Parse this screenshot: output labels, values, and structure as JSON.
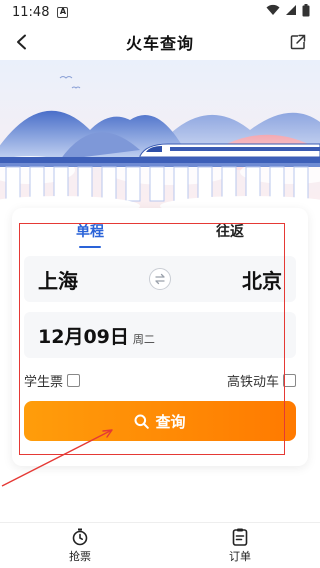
{
  "status_bar": {
    "time": "11:48",
    "app_badge": "A"
  },
  "header": {
    "title": "火车查询"
  },
  "tabs": [
    {
      "label": "单程",
      "active": true
    },
    {
      "label": "往返",
      "active": false
    }
  ],
  "route": {
    "from": "上海",
    "to": "北京"
  },
  "date": {
    "main": "12月09日",
    "weekday": "周二"
  },
  "options": {
    "student_ticket": {
      "label": "学生票",
      "checked": false
    },
    "high_speed": {
      "label": "高铁动车",
      "checked": false
    }
  },
  "search_button": {
    "label": "查询"
  },
  "bottom_nav": [
    {
      "label": "抢票",
      "icon": "stopwatch-icon"
    },
    {
      "label": "订单",
      "icon": "order-list-icon"
    }
  ],
  "colors": {
    "accent_blue": "#2a63d8",
    "button_orange_start": "#ff9d0b",
    "button_orange_end": "#ff7a00",
    "highlight_red": "#e53935"
  }
}
